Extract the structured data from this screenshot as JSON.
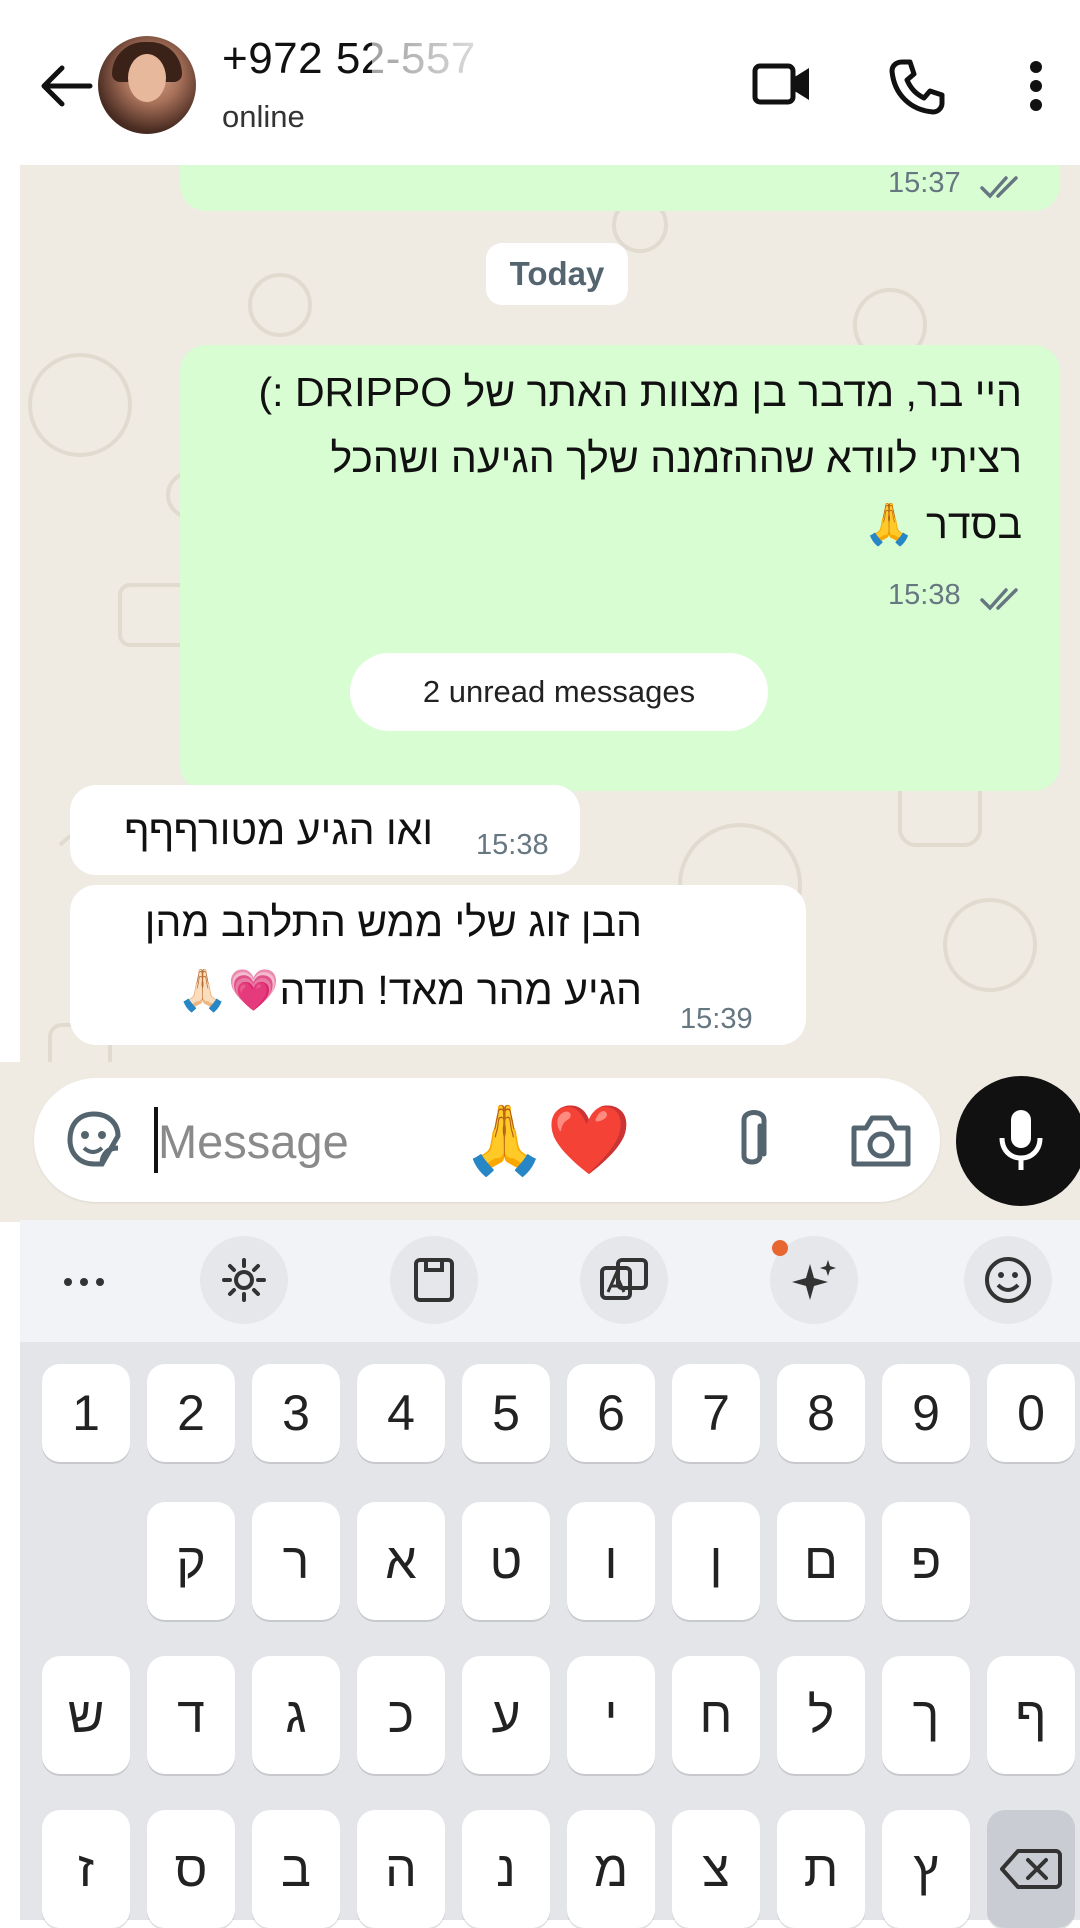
{
  "header": {
    "contact_name": "+972 52-557",
    "status": "online",
    "icons": [
      "arrow-back-icon",
      "video-call-icon",
      "phone-call-icon",
      "more-vert-icon"
    ]
  },
  "chat": {
    "prev_time": "15:37",
    "date_chip": "Today",
    "outgoing": {
      "lines": [
        "היי בר, מדבר בן מצוות האתר של DRIPPO :)",
        "רציתי לוודא שההזמנה שלך הגיעה ושהכל",
        "בסדר 🙏"
      ],
      "time": "15:38"
    },
    "unread_chip": "2 unread messages",
    "incoming": [
      {
        "text": "ואו הגיע מטורףףף",
        "time": "15:38"
      },
      {
        "lines": [
          "הבן זוג שלי ממש התלהב מהן",
          "הגיע מהר מאד! תודה💗🙏🏻"
        ],
        "time": "15:39"
      }
    ]
  },
  "composer": {
    "placeholder": "Message",
    "emoji_suggestions": "🙏❤️",
    "icons": [
      "sticker-icon",
      "attach-icon",
      "camera-icon",
      "mic-icon"
    ]
  },
  "keyboard": {
    "toolbar": [
      "more-icon",
      "settings-icon",
      "clipboard-icon",
      "translate-icon",
      "sparkle-ai-icon",
      "emoji-icon"
    ],
    "row_numbers": [
      "1",
      "2",
      "3",
      "4",
      "5",
      "6",
      "7",
      "8",
      "9",
      "0"
    ],
    "row1": [
      "ק",
      "ר",
      "א",
      "ט",
      "ו",
      "ן",
      "ם",
      "פ"
    ],
    "row2": [
      "ש",
      "ד",
      "ג",
      "כ",
      "ע",
      "י",
      "ח",
      "ל",
      "ך",
      "ף"
    ],
    "row3": [
      "ז",
      "ס",
      "ב",
      "ה",
      "נ",
      "מ",
      "צ",
      "ת",
      "ץ"
    ]
  },
  "colors": {
    "outgoing_bubble": "#d9fdd3",
    "chat_background": "#efeae2",
    "mic_button": "#111111",
    "ticks": "#667781"
  }
}
